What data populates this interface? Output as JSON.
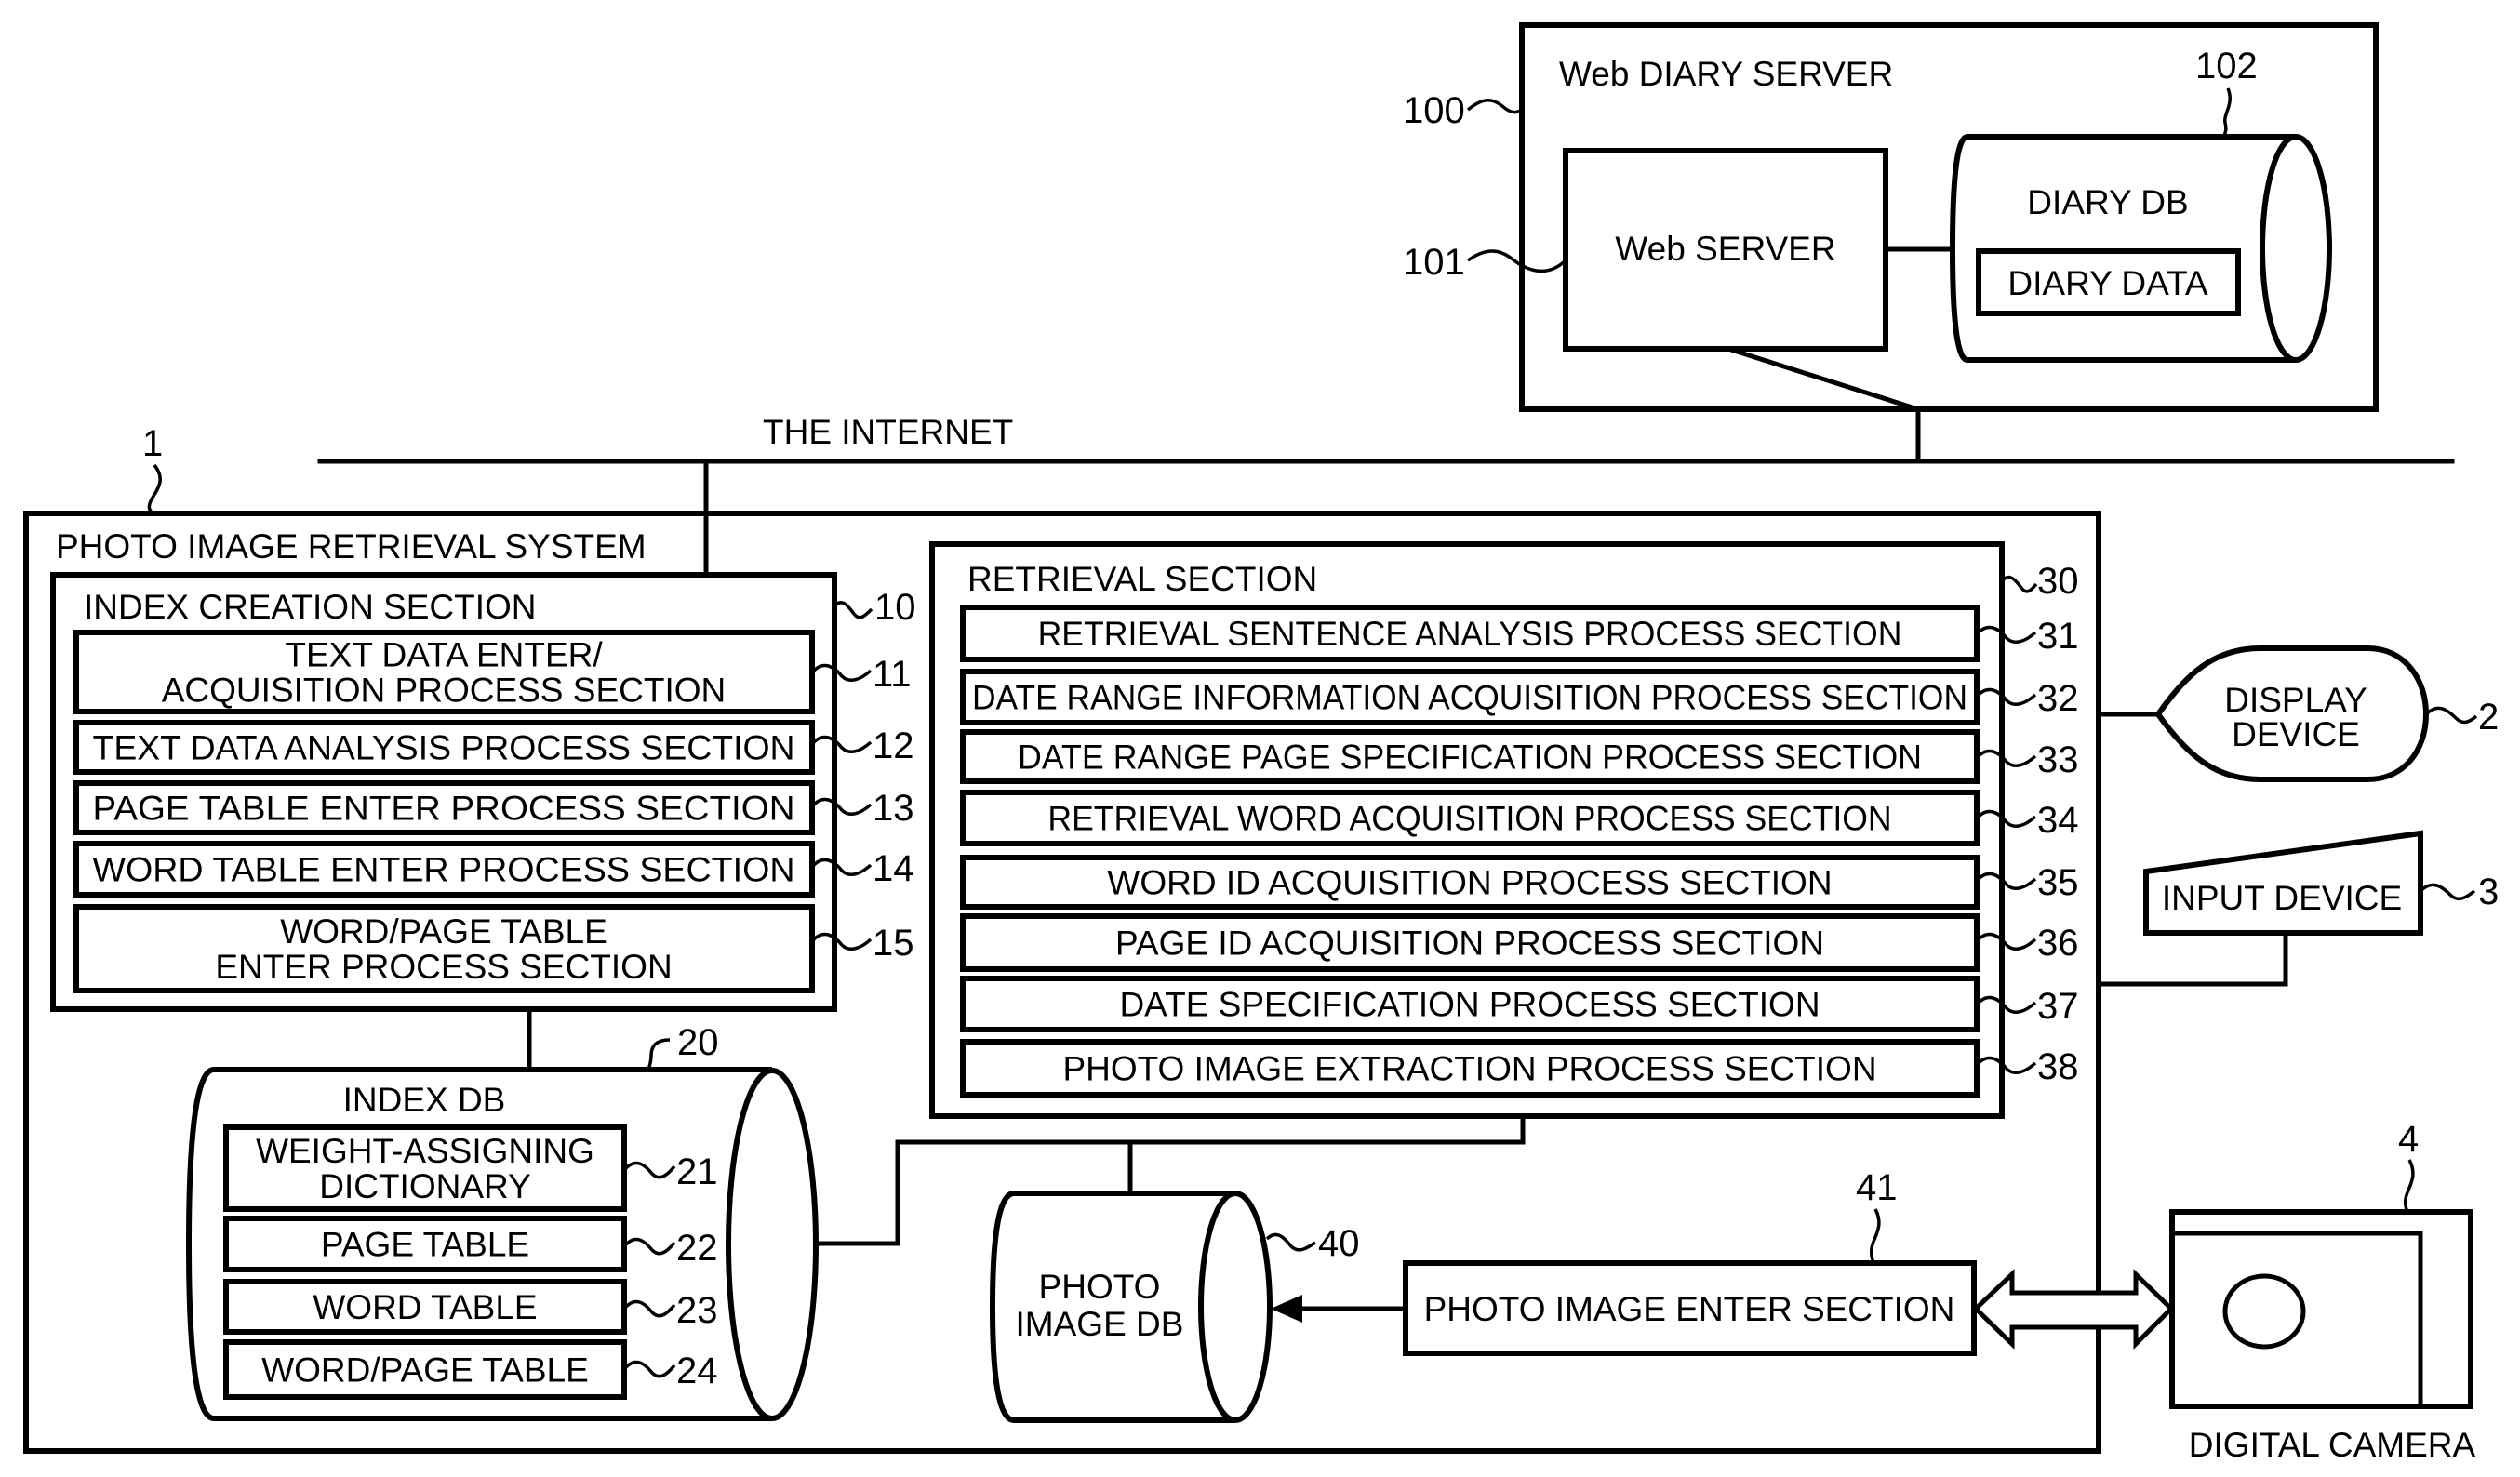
{
  "colors": {
    "stroke": "#000000",
    "background": "#ffffff"
  },
  "network": {
    "label": "THE INTERNET"
  },
  "web_diary_server": {
    "ref": "100",
    "title": "Web DIARY SERVER",
    "web_server": {
      "ref": "101",
      "label": "Web SERVER"
    },
    "diary_db": {
      "ref": "102",
      "label": "DIARY DB",
      "content": "DIARY DATA"
    }
  },
  "system": {
    "ref": "1",
    "title": "PHOTO IMAGE RETRIEVAL SYSTEM",
    "index_creation": {
      "ref": "10",
      "title": "INDEX CREATION SECTION",
      "items": [
        {
          "ref": "11",
          "lines": [
            "TEXT DATA ENTER/",
            "ACQUISITION PROCESS SECTION"
          ]
        },
        {
          "ref": "12",
          "lines": [
            "TEXT DATA ANALYSIS PROCESS SECTION"
          ]
        },
        {
          "ref": "13",
          "lines": [
            "PAGE TABLE ENTER PROCESS SECTION"
          ]
        },
        {
          "ref": "14",
          "lines": [
            "WORD TABLE ENTER PROCESS SECTION"
          ]
        },
        {
          "ref": "15",
          "lines": [
            "WORD/PAGE TABLE",
            "ENTER PROCESS SECTION"
          ]
        }
      ]
    },
    "index_db": {
      "ref": "20",
      "title": "INDEX DB",
      "items": [
        {
          "ref": "21",
          "lines": [
            "WEIGHT-ASSIGNING",
            "DICTIONARY"
          ]
        },
        {
          "ref": "22",
          "lines": [
            "PAGE TABLE"
          ]
        },
        {
          "ref": "23",
          "lines": [
            "WORD TABLE"
          ]
        },
        {
          "ref": "24",
          "lines": [
            "WORD/PAGE TABLE"
          ]
        }
      ]
    },
    "retrieval": {
      "ref": "30",
      "title": "RETRIEVAL SECTION",
      "items": [
        {
          "ref": "31",
          "label": "RETRIEVAL SENTENCE ANALYSIS PROCESS SECTION"
        },
        {
          "ref": "32",
          "label": "DATE RANGE INFORMATION ACQUISITION PROCESS SECTION"
        },
        {
          "ref": "33",
          "label": "DATE RANGE PAGE SPECIFICATION PROCESS SECTION"
        },
        {
          "ref": "34",
          "label": "RETRIEVAL WORD ACQUISITION PROCESS SECTION"
        },
        {
          "ref": "35",
          "label": "WORD ID ACQUISITION PROCESS SECTION"
        },
        {
          "ref": "36",
          "label": "PAGE ID ACQUISITION PROCESS SECTION"
        },
        {
          "ref": "37",
          "label": "DATE SPECIFICATION PROCESS SECTION"
        },
        {
          "ref": "38",
          "label": "PHOTO IMAGE EXTRACTION PROCESS SECTION"
        }
      ]
    },
    "photo_db": {
      "ref": "40",
      "lines": [
        "PHOTO",
        "IMAGE DB"
      ]
    },
    "photo_enter": {
      "ref": "41",
      "label": "PHOTO IMAGE ENTER SECTION"
    }
  },
  "display_device": {
    "ref": "2",
    "lines": [
      "DISPLAY",
      "DEVICE"
    ]
  },
  "input_device": {
    "ref": "3",
    "label": "INPUT DEVICE"
  },
  "digital_camera": {
    "ref": "4",
    "label": "DIGITAL CAMERA"
  }
}
